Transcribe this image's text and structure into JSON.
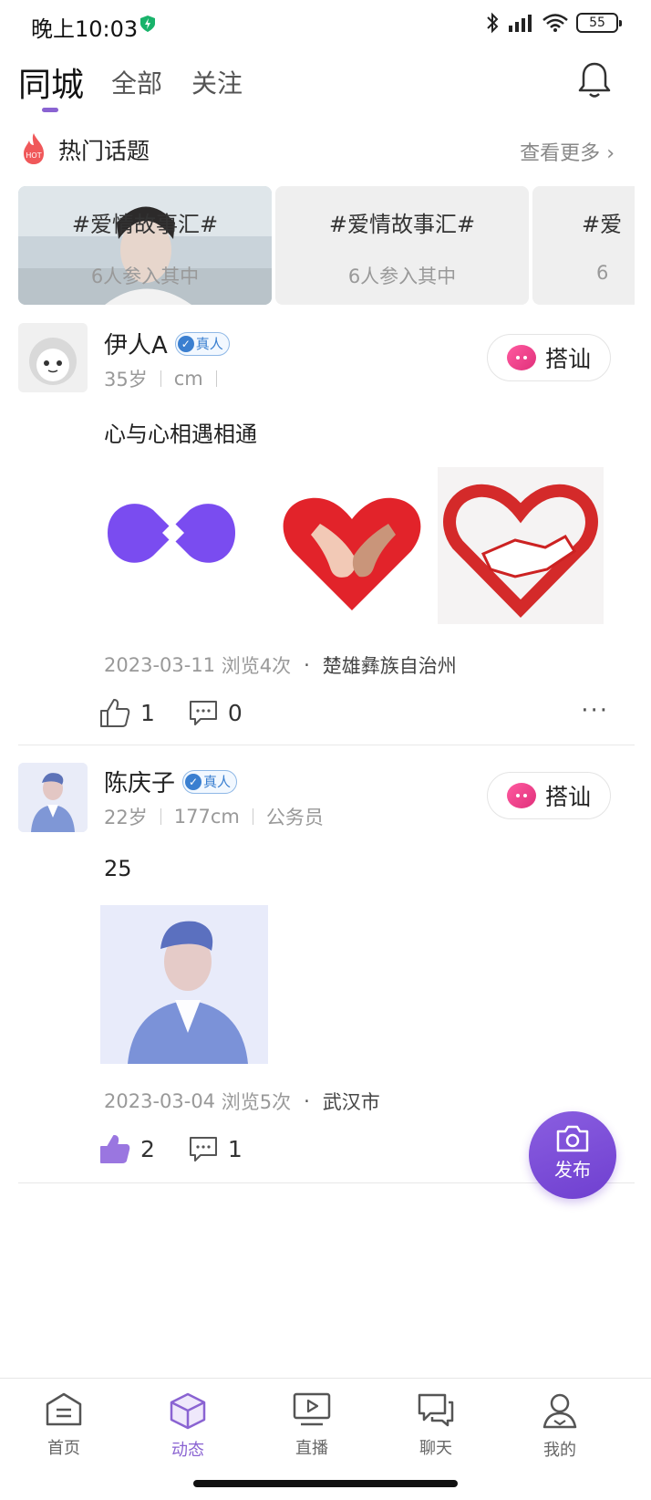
{
  "status_bar": {
    "time": "晚上10:03",
    "battery": "55"
  },
  "top_tabs": [
    {
      "label": "同城"
    },
    {
      "label": "全部"
    },
    {
      "label": "关注"
    }
  ],
  "hot_topics": {
    "title": "热门话题",
    "see_more": "查看更多",
    "cards": [
      {
        "title": "#爱情故事汇#",
        "count": "6人参入其中"
      },
      {
        "title": "#爱情故事汇#",
        "count": "6人参入其中"
      },
      {
        "title": "#爱",
        "count": "6"
      }
    ]
  },
  "posts": [
    {
      "name": "伊人A",
      "verified": "真人",
      "age": "35岁",
      "height": "cm",
      "job": "",
      "chat_label": "搭讪",
      "text": "心与心相遇相通",
      "date": "2023-03-11",
      "views": "浏览4次",
      "location": "楚雄彝族自治州",
      "likes": "1",
      "comments": "0"
    },
    {
      "name": "陈庆子",
      "verified": "真人",
      "age": "22岁",
      "height": "177cm",
      "job": "公务员",
      "chat_label": "搭讪",
      "text": "25",
      "date": "2023-03-04",
      "views": "浏览5次",
      "location": "武汉市",
      "likes": "2",
      "comments": "1"
    }
  ],
  "fab": {
    "label": "发布"
  },
  "tabbar": [
    {
      "label": "首页",
      "icon": "home-icon"
    },
    {
      "label": "动态",
      "icon": "cube-icon"
    },
    {
      "label": "直播",
      "icon": "live-tv-icon"
    },
    {
      "label": "聊天",
      "icon": "chat-icon"
    },
    {
      "label": "我的",
      "icon": "profile-icon"
    }
  ],
  "colors": {
    "accent": "#8a63d2",
    "pink": "#e0307a",
    "verified": "#3a7fd0"
  }
}
